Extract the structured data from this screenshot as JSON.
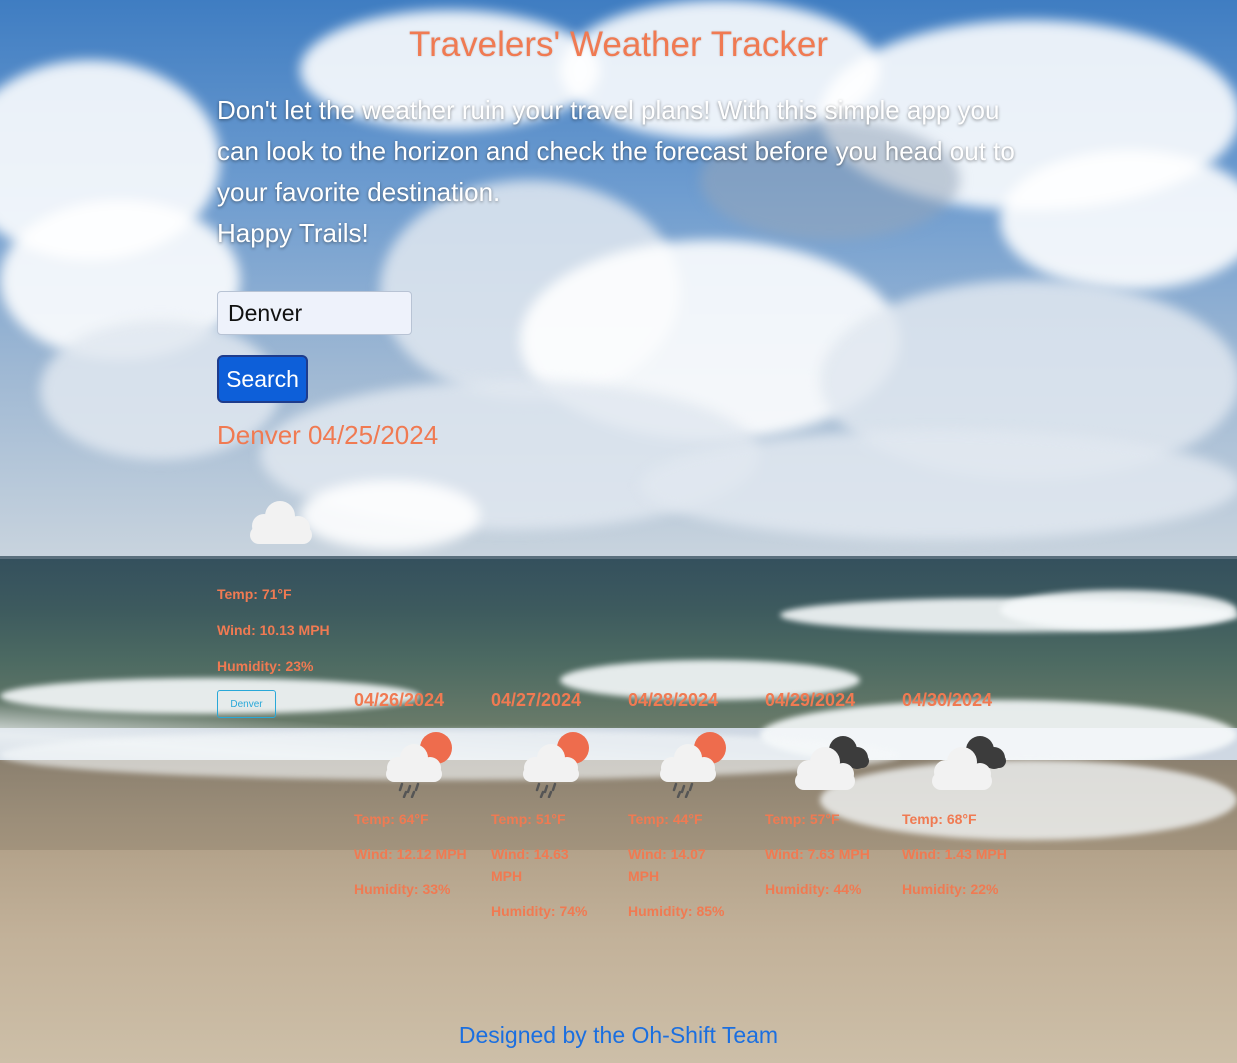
{
  "header": {
    "title": "Travelers' Weather Tracker"
  },
  "intro": {
    "line1": "Don't let the weather ruin your travel plans! With this simple app you can look to the horizon and check the forecast before you head out to your favorite destination.",
    "line2": "Happy Trails!"
  },
  "search": {
    "value": "Denver",
    "button_label": "Search"
  },
  "history": {
    "items": [
      "Denver"
    ]
  },
  "current": {
    "heading": "Denver 04/25/2024",
    "icon": "cloud-icon",
    "temp": "Temp: 71°F",
    "wind": "Wind: 10.13 MPH",
    "humidity": "Humidity: 23%"
  },
  "forecast": [
    {
      "date": "04/26/2024",
      "icon": "sun-cloud-rain-icon",
      "temp": "Temp: 64°F",
      "wind": "Wind: 12.12 MPH",
      "humidity": "Humidity: 33%"
    },
    {
      "date": "04/27/2024",
      "icon": "sun-cloud-rain-icon",
      "temp": "Temp: 51°F",
      "wind": "Wind: 14.63 MPH",
      "humidity": "Humidity: 74%"
    },
    {
      "date": "04/28/2024",
      "icon": "sun-cloud-rain-icon",
      "temp": "Temp: 44°F",
      "wind": "Wind: 14.07 MPH",
      "humidity": "Humidity: 85%"
    },
    {
      "date": "04/29/2024",
      "icon": "broken-clouds-icon",
      "temp": "Temp: 57°F",
      "wind": "Wind: 7.63 MPH",
      "humidity": "Humidity: 44%"
    },
    {
      "date": "04/30/2024",
      "icon": "broken-clouds-icon",
      "temp": "Temp: 68°F",
      "wind": "Wind: 1.43 MPH",
      "humidity": "Humidity: 22%"
    }
  ],
  "footer": {
    "text": "Designed by the Oh-Shift Team"
  },
  "colors": {
    "accent": "#f07a52",
    "button": "#0d5fd9",
    "footer": "#1b6fe0",
    "history_button": "#29a8d8"
  }
}
